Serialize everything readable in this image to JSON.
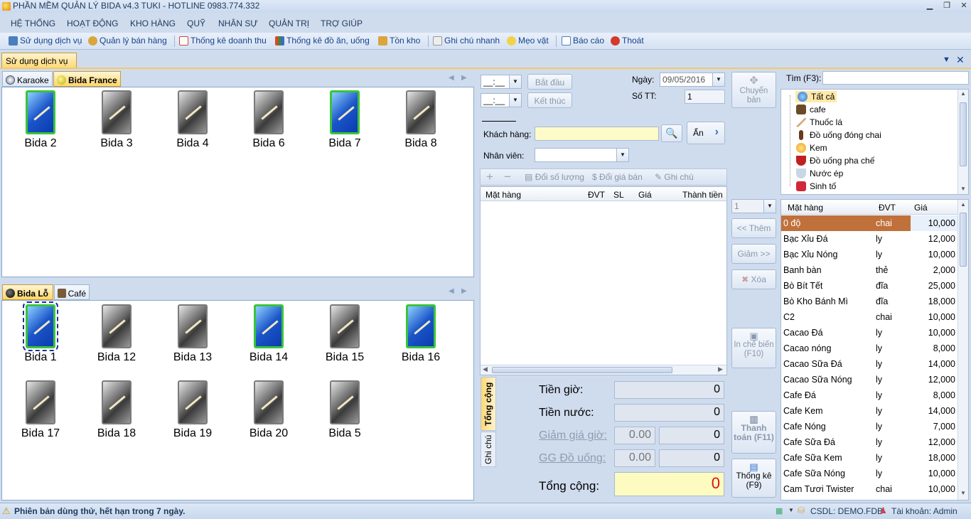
{
  "window": {
    "title": "PHẦN MỀM QUẢN LÝ BIDA v4.3 TUKI - HOTLINE 0983.774.332",
    "min": "▁",
    "restore": "❐",
    "close": "✕"
  },
  "menu": [
    "HỆ THỐNG",
    "HOẠT ĐỘNG",
    "KHO HÀNG",
    "QUỸ",
    "NHÂN SỰ",
    "QUẢN TRỊ",
    "TRỢ GIÚP"
  ],
  "toolbar": [
    {
      "label": "Sử dụng dịch vụ",
      "icon": "service-icon",
      "color": "#4a7fc1"
    },
    {
      "label": "Quản lý bán hàng",
      "icon": "search-icon",
      "color": "#d9a53c"
    },
    {
      "label": "Thống kê doanh thu",
      "icon": "chart-icon",
      "color": "#c84b3c"
    },
    {
      "label": "Thống kê đồ ăn, uống",
      "icon": "bar-chart-icon",
      "color": "#d84a2b"
    },
    {
      "label": "Tồn kho",
      "icon": "warehouse-icon",
      "color": "#d9a53c"
    },
    {
      "label": "Ghi chú nhanh",
      "icon": "note-icon",
      "color": "#d8d8d8"
    },
    {
      "label": "Mẹo vặt",
      "icon": "lightbulb-icon",
      "color": "#f0d34a"
    },
    {
      "label": "Báo cáo",
      "icon": "report-icon",
      "color": "#4a7fc1"
    },
    {
      "label": "Thoát",
      "icon": "exit-icon",
      "color": "#d43a2a"
    }
  ],
  "doc_tab": "Sử dụng dịch vụ",
  "top_group": {
    "tabs": [
      {
        "label": "Karaoke",
        "active": false
      },
      {
        "label": "Bida France",
        "active": true
      }
    ],
    "tables": [
      {
        "name": "Bida 2",
        "busy": true
      },
      {
        "name": "Bida 3",
        "busy": false
      },
      {
        "name": "Bida 4",
        "busy": false
      },
      {
        "name": "Bida 6",
        "busy": false
      },
      {
        "name": "Bida 7",
        "busy": true
      },
      {
        "name": "Bida 8",
        "busy": false
      }
    ]
  },
  "bottom_group": {
    "tabs": [
      {
        "label": "Bida Lỗ",
        "active": true
      },
      {
        "label": "Café",
        "active": false
      }
    ],
    "tables": [
      {
        "name": "Bida 1",
        "busy": true,
        "selected": true
      },
      {
        "name": "Bida 12",
        "busy": false
      },
      {
        "name": "Bida 13",
        "busy": false
      },
      {
        "name": "Bida 14",
        "busy": true
      },
      {
        "name": "Bida 15",
        "busy": false
      },
      {
        "name": "Bida 16",
        "busy": true
      },
      {
        "name": "Bida 17",
        "busy": false
      },
      {
        "name": "Bida 18",
        "busy": false
      },
      {
        "name": "Bida 19",
        "busy": false
      },
      {
        "name": "Bida 20",
        "busy": false
      },
      {
        "name": "Bida 5",
        "busy": false
      }
    ]
  },
  "session": {
    "time1": "__:__",
    "time2": "__:__",
    "start_btn": "Bắt đầu",
    "end_btn": "Kết thúc",
    "date_label": "Ngày:",
    "date": "09/05/2016",
    "stt_label": "Số TT:",
    "stt": "1",
    "transfer_btn": "Chuyển bàn",
    "customer_label": "Khách hàng:",
    "customer": "",
    "staff_label": "Nhân viên:",
    "staff": "",
    "hide_btn": "Ẩn"
  },
  "order_toolbar": {
    "plus": "+",
    "minus": "−",
    "change_qty": "Đổi số lượng",
    "change_price": "Đổi giá bán",
    "note": "Ghi chú"
  },
  "order_columns": [
    "Mặt hàng",
    "ĐVT",
    "SL",
    "Giá",
    "Thành tiền"
  ],
  "middle_buttons": {
    "qty": "1",
    "add": "<< Thêm",
    "reduce": "Giảm >>",
    "delete": "Xóa",
    "print": "In chế biến (F10)",
    "pay": "Thanh toán (F11)",
    "stats": "Thống kê (F9)"
  },
  "totals": {
    "tab_total": "Tổng cộng",
    "tab_note": "Ghi chú",
    "time_label": "Tiền giờ:",
    "time_value": "0",
    "drink_label": "Tiền nước:",
    "drink_value": "0",
    "disc_time_label": "Giảm giá giờ:",
    "disc_time_pct": "0.00",
    "disc_time_value": "0",
    "disc_drink_label": "GG Đồ uống:",
    "disc_drink_pct": "0.00",
    "disc_drink_value": "0",
    "total_label": "Tổng cộng:",
    "total_value": "0"
  },
  "search": {
    "label": "Tìm (F3):",
    "value": ""
  },
  "categories": [
    {
      "label": "Tất cả",
      "icon": "globe-icon",
      "color": "#4a90d9"
    },
    {
      "label": "cafe",
      "icon": "coffee-icon",
      "color": "#6b4a2a"
    },
    {
      "label": "Thuốc lá",
      "icon": "cigarette-icon",
      "color": "#d0b080"
    },
    {
      "label": "Đồ uống đóng chai",
      "icon": "bottle-icon",
      "color": "#6a3b1a"
    },
    {
      "label": "Kem",
      "icon": "icecream-icon",
      "color": "#f0b030"
    },
    {
      "label": "Đồ uống pha chế",
      "icon": "cocktail-icon",
      "color": "#c02020"
    },
    {
      "label": "Nước ép",
      "icon": "juice-icon",
      "color": "#9ab0c8"
    },
    {
      "label": "Sinh tố",
      "icon": "smoothie-icon",
      "color": "#d02838"
    }
  ],
  "product_columns": [
    "Mặt hàng",
    "ĐVT",
    "Giá"
  ],
  "products": [
    {
      "name": "0 độ",
      "unit": "chai",
      "price": "10,000"
    },
    {
      "name": "Bạc Xỉu Đá",
      "unit": "ly",
      "price": "12,000"
    },
    {
      "name": "Bạc Xỉu Nóng",
      "unit": "ly",
      "price": "10,000"
    },
    {
      "name": "Banh bàn",
      "unit": "thẻ",
      "price": "2,000"
    },
    {
      "name": "Bò Bít Tết",
      "unit": "đĩa",
      "price": "25,000"
    },
    {
      "name": "Bò Kho Bánh Mì",
      "unit": "đĩa",
      "price": "18,000"
    },
    {
      "name": "C2",
      "unit": "chai",
      "price": "10,000"
    },
    {
      "name": "Cacao Đá",
      "unit": "ly",
      "price": "10,000"
    },
    {
      "name": "Cacao nóng",
      "unit": "ly",
      "price": "8,000"
    },
    {
      "name": "Cacao Sữa Đá",
      "unit": "ly",
      "price": "14,000"
    },
    {
      "name": "Cacao Sữa Nóng",
      "unit": "ly",
      "price": "12,000"
    },
    {
      "name": "Cafe Đá",
      "unit": "ly",
      "price": "8,000"
    },
    {
      "name": "Cafe Kem",
      "unit": "ly",
      "price": "14,000"
    },
    {
      "name": "Cafe Nóng",
      "unit": "ly",
      "price": "7,000"
    },
    {
      "name": "Cafe Sữa Đá",
      "unit": "ly",
      "price": "12,000"
    },
    {
      "name": "Cafe Sữa Kem",
      "unit": "ly",
      "price": "18,000"
    },
    {
      "name": "Cafe Sữa Nóng",
      "unit": "ly",
      "price": "10,000"
    },
    {
      "name": "Cam Tươi Twister",
      "unit": "chai",
      "price": "10,000"
    }
  ],
  "status": {
    "warning": "Phiên bản dùng thử, hết hạn trong 7 ngày.",
    "db": "CSDL: DEMO.FDB",
    "account": "Tài khoản: Admin"
  }
}
